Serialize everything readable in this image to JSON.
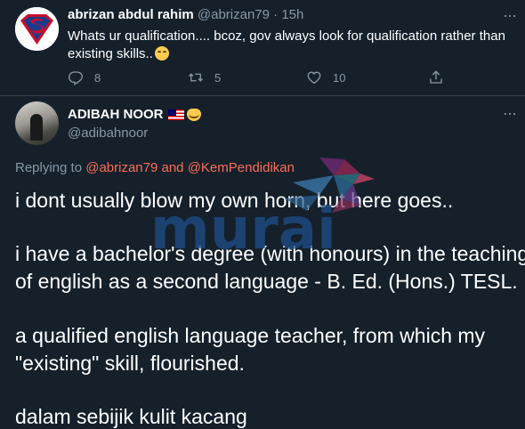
{
  "tweet1": {
    "name": "abrizan abdul rahim",
    "handle": "@abrizan79",
    "separator": "·",
    "time": "15h",
    "more": "···",
    "text": "Whats ur qualification.... bcoz, gov always look for qualification rather than existing skills..",
    "emoji_icon": "relieved-face-emoji",
    "actions": {
      "replies": "8",
      "retweets": "5",
      "likes": "10"
    }
  },
  "tweet2": {
    "name": "ADIBAH NOOR",
    "name_icons": [
      "malaysia-flag-emoji",
      "smirking-cat-emoji"
    ],
    "handle": "@adibahnoor",
    "more": "···",
    "replying_prefix": "Replying to",
    "mention1": "@abrizan79",
    "replying_and": "and",
    "mention2": "@KemPendidikan",
    "lines": [
      "i dont usually blow my own horn, but here goes..",
      "i have a bachelor's degree (with honours) in the teaching",
      "of english as a second language - B. Ed. (Hons.) TESL.",
      "a qualified english language teacher, from which my",
      "\"existing\" skill, flourished.",
      "dalam sebijik kulit kacang"
    ]
  },
  "watermark": {
    "text": "murai"
  },
  "colors": {
    "background": "#15202b",
    "text": "#ffffff",
    "muted": "#8899a6",
    "link": "#1da1f2",
    "divider": "#38444d"
  }
}
